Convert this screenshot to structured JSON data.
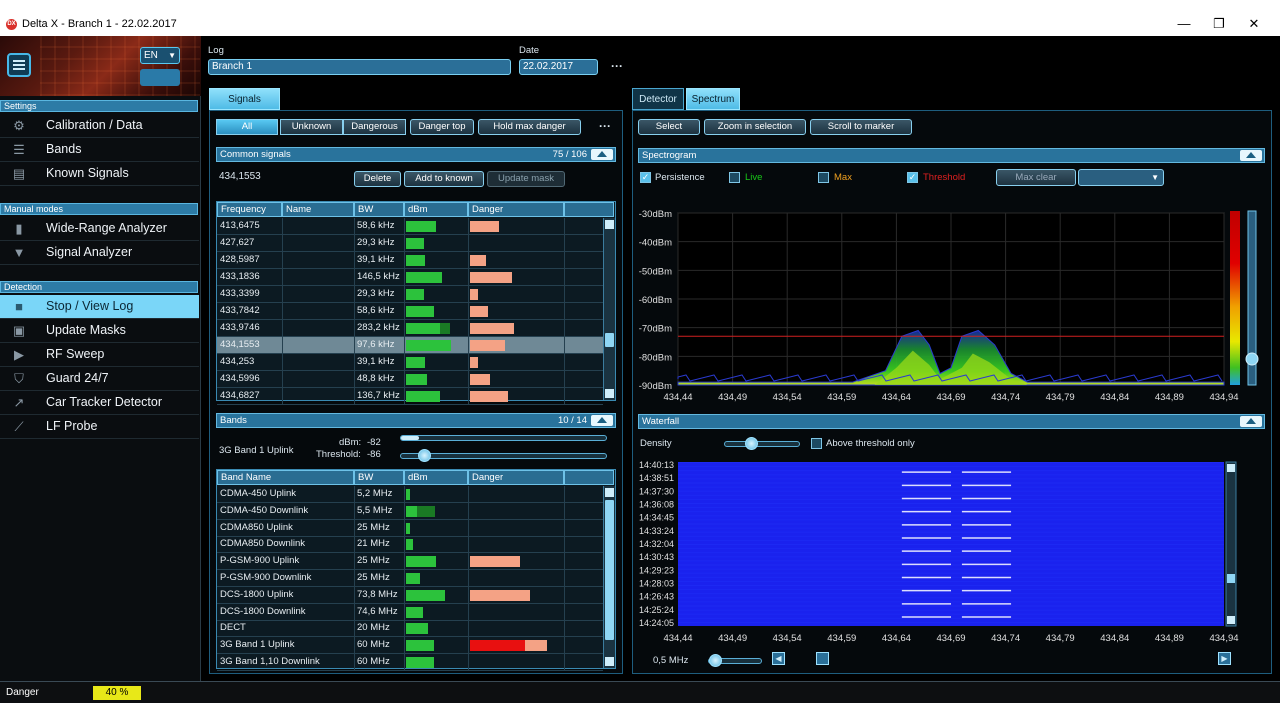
{
  "window": {
    "title": "Delta X - Branch 1 - 22.02.2017",
    "logo": "DX",
    "minimize": "—",
    "maximize": "❐",
    "close": "✕"
  },
  "sidebar": {
    "language": "EN",
    "sections": [
      {
        "title": "Settings",
        "items": [
          {
            "label": "Calibration / Data",
            "icon": "gear-icon",
            "glyph": "⚙"
          },
          {
            "label": "Bands",
            "icon": "list-icon",
            "glyph": "☰"
          },
          {
            "label": "Known Signals",
            "icon": "clipboard-icon",
            "glyph": "▤"
          }
        ]
      },
      {
        "title": "Manual modes",
        "items": [
          {
            "label": "Wide-Range Analyzer",
            "icon": "bar-chart-icon",
            "glyph": "▮"
          },
          {
            "label": "Signal Analyzer",
            "icon": "antenna-icon",
            "glyph": "▼"
          }
        ]
      },
      {
        "title": "Detection",
        "items": [
          {
            "label": "Stop / View Log",
            "icon": "stop-icon",
            "glyph": "■",
            "active": true
          },
          {
            "label": "Update Masks",
            "icon": "image-icon",
            "glyph": "▣"
          },
          {
            "label": "RF Sweep",
            "icon": "play-icon",
            "glyph": "▶"
          },
          {
            "label": "Guard 24/7",
            "icon": "shield-icon",
            "glyph": "⛉"
          },
          {
            "label": "Car Tracker Detector",
            "icon": "trend-icon",
            "glyph": "↗"
          },
          {
            "label": "LF Probe",
            "icon": "probe-icon",
            "glyph": "⟋"
          }
        ]
      }
    ]
  },
  "header": {
    "log_label": "Log",
    "log_value": "Branch 1",
    "date_label": "Date",
    "date_value": "22.02.2017",
    "more": "···"
  },
  "signals": {
    "tab": "Signals",
    "filters": [
      {
        "label": "All",
        "selected": true
      },
      {
        "label": "Unknown"
      },
      {
        "label": "Dangerous"
      }
    ],
    "danger_top": "Danger top",
    "hold_max": "Hold max danger",
    "more": "···",
    "common": {
      "title": "Common signals",
      "count": "75 / 106",
      "selected_freq": "434,1553",
      "delete": "Delete",
      "add_known": "Add to known",
      "update_mask": "Update mask",
      "columns": [
        "Frequency",
        "Name",
        "BW",
        "dBm",
        "Danger"
      ],
      "rows": [
        {
          "freq": "413,6475",
          "name": "",
          "bw": "58,6 kHz",
          "dbm": 0.55,
          "dbm2": 0,
          "danger": 0.45
        },
        {
          "freq": "427,627",
          "name": "",
          "bw": "29,3 kHz",
          "dbm": 0.33,
          "dbm2": 0,
          "danger": 0.0
        },
        {
          "freq": "428,5987",
          "name": "",
          "bw": "39,1 kHz",
          "dbm": 0.35,
          "dbm2": 0,
          "danger": 0.25
        },
        {
          "freq": "433,1836",
          "name": "",
          "bw": "146,5 kHz",
          "dbm": 0.65,
          "dbm2": 0,
          "danger": 0.65
        },
        {
          "freq": "433,3399",
          "name": "",
          "bw": "29,3 kHz",
          "dbm": 0.33,
          "dbm2": 0,
          "danger": 0.12
        },
        {
          "freq": "433,7842",
          "name": "",
          "bw": "58,6 kHz",
          "dbm": 0.5,
          "dbm2": 0,
          "danger": 0.28
        },
        {
          "freq": "433,9746",
          "name": "",
          "bw": "283,2 kHz",
          "dbm": 0.62,
          "dbm2": 0.18,
          "danger": 0.68
        },
        {
          "freq": "434,1553",
          "name": "",
          "bw": "97,6 kHz",
          "dbm": 0.82,
          "dbm2": 0,
          "danger": 0.55,
          "selected": true
        },
        {
          "freq": "434,253",
          "name": "",
          "bw": "39,1 kHz",
          "dbm": 0.35,
          "dbm2": 0,
          "danger": 0.12
        },
        {
          "freq": "434,5996",
          "name": "",
          "bw": "48,8 kHz",
          "dbm": 0.38,
          "dbm2": 0,
          "danger": 0.32
        },
        {
          "freq": "434,6827",
          "name": "",
          "bw": "136,7 kHz",
          "dbm": 0.62,
          "dbm2": 0,
          "danger": 0.6
        }
      ]
    },
    "bands": {
      "title": "Bands",
      "count": "10 / 14",
      "selected_band": "3G Band 1 Uplink",
      "dbm_label": "dBm:",
      "dbm_value": "-82",
      "dbm_level": 0.09,
      "threshold_label": "Threshold:",
      "threshold_value": "-86",
      "threshold_level": 0.08,
      "columns": [
        "Band Name",
        "BW",
        "dBm",
        "Danger"
      ],
      "rows": [
        {
          "name": "CDMA-450 Uplink",
          "bw": "5,2 MHz",
          "dbm": 0.08,
          "dbm2": 0,
          "danger": 0.0,
          "dcolor": "#f4a285"
        },
        {
          "name": "CDMA-450 Downlink",
          "bw": "5,5 MHz",
          "dbm": 0.2,
          "dbm2": 0.32,
          "danger": 0.0,
          "dcolor": "#f4a285"
        },
        {
          "name": "CDMA850 Uplink",
          "bw": "25 MHz",
          "dbm": 0.08,
          "dbm2": 0,
          "danger": 0.0,
          "dcolor": "#f4a285"
        },
        {
          "name": "CDMA850 Downlink",
          "bw": "21 MHz",
          "dbm": 0.12,
          "dbm2": 0,
          "danger": 0.0,
          "dcolor": "#f4a285"
        },
        {
          "name": "P-GSM-900 Uplink",
          "bw": "25 MHz",
          "dbm": 0.55,
          "dbm2": 0,
          "danger": 0.6,
          "dcolor": "#f4a285"
        },
        {
          "name": "P-GSM-900 Downlink",
          "bw": "25 MHz",
          "dbm": 0.25,
          "dbm2": 0,
          "danger": 0.0,
          "dcolor": "#f4a285"
        },
        {
          "name": "DCS-1800 Uplink",
          "bw": "73,8 MHz",
          "dbm": 0.7,
          "dbm2": 0,
          "danger": 0.72,
          "dcolor": "#f4a285"
        },
        {
          "name": "DCS-1800 Downlink",
          "bw": "74,6 MHz",
          "dbm": 0.3,
          "dbm2": 0,
          "danger": 0.0,
          "dcolor": "#f4a285"
        },
        {
          "name": "DECT",
          "bw": "20 MHz",
          "dbm": 0.4,
          "dbm2": 0,
          "danger": 0.0,
          "dcolor": "#f4a285"
        },
        {
          "name": "3G Band 1 Uplink",
          "bw": "60 MHz",
          "dbm": 0.5,
          "dbm2": 0,
          "danger": 0.92,
          "dcolor": "#e81010"
        },
        {
          "name": "3G Band 1,10 Downlink",
          "bw": "60 MHz",
          "dbm": 0.5,
          "dbm2": 0,
          "danger": 0.0,
          "dcolor": "#f4a285"
        }
      ]
    }
  },
  "spectrum": {
    "tabs": [
      {
        "label": "Detector"
      },
      {
        "label": "Spectrum",
        "selected": true
      }
    ],
    "toolbar": {
      "select": "Select",
      "zoom": "Zoom in selection",
      "scroll": "Scroll to marker"
    },
    "spectrogram": {
      "title": "Spectrogram",
      "persistence": "Persistence",
      "live": "Live",
      "max": "Max",
      "threshold": "Threshold",
      "max_clear": "Max clear",
      "dropdown_value": "",
      "colors": {
        "live": "#18c818",
        "max": "#f0a020",
        "threshold": "#e02020"
      }
    },
    "waterfall": {
      "title": "Waterfall",
      "density": "Density",
      "above_threshold": "Above threshold only",
      "times": [
        "14:40:13",
        "14:38:51",
        "14:37:30",
        "14:36:08",
        "14:34:45",
        "14:33:24",
        "14:32:04",
        "14:30:43",
        "14:29:23",
        "14:28:03",
        "14:26:43",
        "14:25:24",
        "14:24:05"
      ],
      "span": "0,5 MHz"
    }
  },
  "status": {
    "label": "Danger",
    "value": "40 %"
  },
  "chart_data": [
    {
      "type": "area",
      "title": "Spectrogram",
      "x_ticks": [
        "434,44",
        "434,49",
        "434,54",
        "434,59",
        "434,64",
        "434,69",
        "434,74",
        "434,79",
        "434,84",
        "434,89",
        "434,94"
      ],
      "y_ticks": [
        "-30dBm",
        "-40dBm",
        "-50dBm",
        "-60dBm",
        "-70dBm",
        "-80dBm",
        "-90dBm"
      ],
      "xlim": [
        434.44,
        434.94
      ],
      "ylim": [
        -90,
        -30
      ],
      "threshold_dbm": -73,
      "series": [
        {
          "name": "Max",
          "x": [
            434.44,
            434.6,
            434.63,
            434.645,
            434.66,
            434.67,
            434.68,
            434.69,
            434.7,
            434.715,
            434.73,
            434.745,
            434.76,
            434.78,
            434.94
          ],
          "y": [
            -89,
            -89,
            -85,
            -73,
            -71,
            -76,
            -86,
            -84,
            -73,
            -71,
            -76,
            -86,
            -89,
            -89,
            -89
          ]
        },
        {
          "name": "Live",
          "x": [
            434.44,
            434.62,
            434.64,
            434.655,
            434.67,
            434.68,
            434.7,
            434.71,
            434.725,
            434.745,
            434.76,
            434.94
          ],
          "y": [
            -90,
            -90,
            -84,
            -78,
            -83,
            -88,
            -84,
            -79,
            -82,
            -88,
            -90,
            -90
          ]
        }
      ],
      "grid": true
    },
    {
      "type": "heatmap",
      "title": "Waterfall",
      "x_ticks": [
        "434,44",
        "434,49",
        "434,54",
        "434,59",
        "434,64",
        "434,69",
        "434,74",
        "434,79",
        "434,84",
        "434,89",
        "434,94"
      ],
      "xlim": [
        434.44,
        434.94
      ],
      "signals": [
        {
          "x_from": 434.645,
          "x_to": 434.69
        },
        {
          "x_from": 434.7,
          "x_to": 434.745
        }
      ]
    }
  ]
}
